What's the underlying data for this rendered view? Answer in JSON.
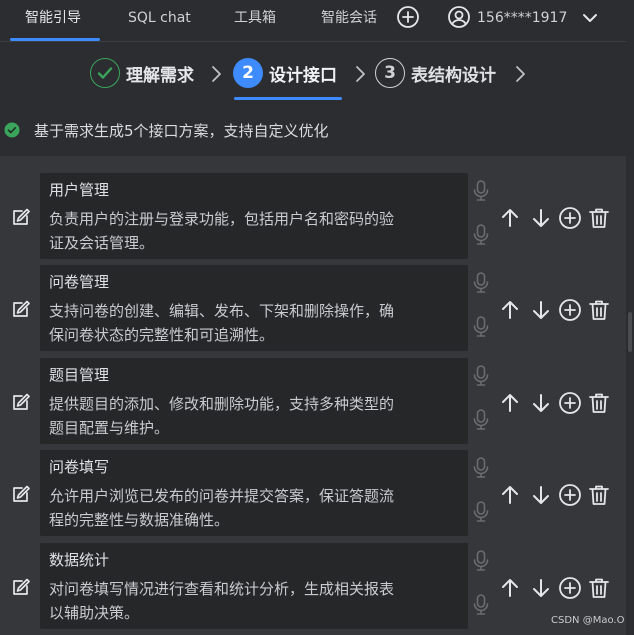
{
  "nav": {
    "tabs": [
      {
        "label": "智能引导",
        "active": true
      },
      {
        "label": "SQL chat",
        "active": false
      },
      {
        "label": "工具箱",
        "active": false
      },
      {
        "label": "智能会话",
        "active": false
      }
    ],
    "add_icon": "plus-circle-icon",
    "user_icon": "user-circle-icon",
    "user_phone": "156****1917",
    "chevron_icon": "chevron-down-icon",
    "accent_color": "#3d8bfd"
  },
  "steps": [
    {
      "number": "",
      "label": "理解需求",
      "status": "done",
      "icon": "check-circle-icon"
    },
    {
      "number": "2",
      "label": "设计接口",
      "status": "active"
    },
    {
      "number": "3",
      "label": "表结构设计",
      "status": "pending"
    }
  ],
  "info": {
    "icon": "check-circle-icon",
    "text": "基于需求生成5个接口方案，支持自定义优化",
    "color": "#3ba55d"
  },
  "interfaces": [
    {
      "title": "用户管理",
      "desc_line1": "负责用户的注册与登录功能，包括用户名和密码的验",
      "desc_line2": "证及会话管理。"
    },
    {
      "title": "问卷管理",
      "desc_line1": "支持问卷的创建、编辑、发布、下架和删除操作，确",
      "desc_line2": "保问卷状态的完整性和可追溯性。"
    },
    {
      "title": "题目管理",
      "desc_line1": "提供题目的添加、修改和删除功能，支持多种类型的",
      "desc_line2": "题目配置与维护。"
    },
    {
      "title": "问卷填写",
      "desc_line1": "允许用户浏览已发布的问卷并提交答案，保证答题流",
      "desc_line2": "程的完整性与数据准确性。"
    },
    {
      "title": "数据统计",
      "desc_line1": "对问卷填写情况进行查看和统计分析，生成相关报表",
      "desc_line2": "以辅助决策。"
    }
  ],
  "row_icons": [
    "edit-icon",
    "mic-icon",
    "arrow-up-icon",
    "arrow-down-icon",
    "plus-circle-icon",
    "trash-icon"
  ],
  "watermark": "CSDN @Mao.O"
}
